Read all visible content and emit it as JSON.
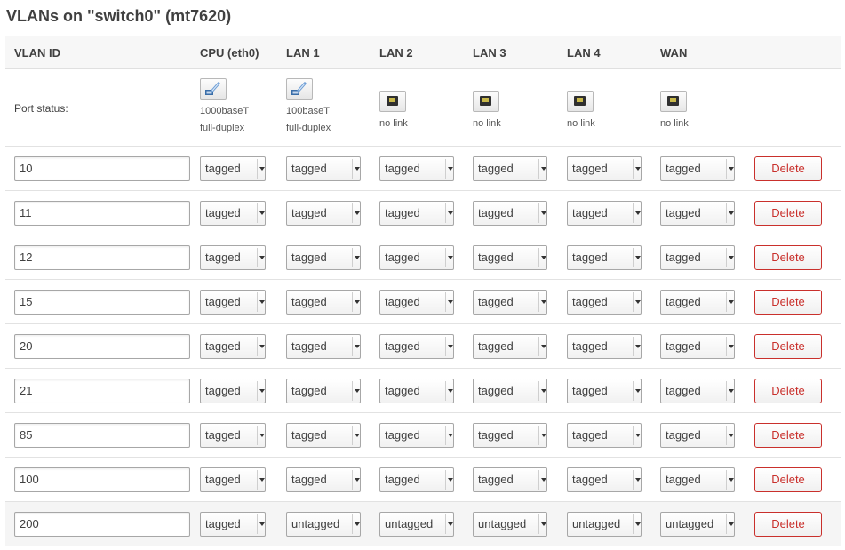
{
  "title": "VLANs on \"switch0\" (mt7620)",
  "columns": [
    "VLAN ID",
    "CPU (eth0)",
    "LAN 1",
    "LAN 2",
    "LAN 3",
    "LAN 4",
    "WAN"
  ],
  "status_label": "Port status:",
  "ports": [
    {
      "speed": "1000baseT",
      "duplex": "full-duplex",
      "icon": "ethernet-cable-connected-icon"
    },
    {
      "speed": "100baseT",
      "duplex": "full-duplex",
      "icon": "ethernet-cable-connected-icon"
    },
    {
      "speed": "no link",
      "duplex": "",
      "icon": "ethernet-port-empty-icon"
    },
    {
      "speed": "no link",
      "duplex": "",
      "icon": "ethernet-port-empty-icon"
    },
    {
      "speed": "no link",
      "duplex": "",
      "icon": "ethernet-port-empty-icon"
    },
    {
      "speed": "no link",
      "duplex": "",
      "icon": "ethernet-port-empty-icon"
    }
  ],
  "delete_label": "Delete",
  "rows": [
    {
      "vid": "10",
      "modes": [
        "tagged",
        "tagged",
        "tagged",
        "tagged",
        "tagged",
        "tagged"
      ]
    },
    {
      "vid": "11",
      "modes": [
        "tagged",
        "tagged",
        "tagged",
        "tagged",
        "tagged",
        "tagged"
      ]
    },
    {
      "vid": "12",
      "modes": [
        "tagged",
        "tagged",
        "tagged",
        "tagged",
        "tagged",
        "tagged"
      ]
    },
    {
      "vid": "15",
      "modes": [
        "tagged",
        "tagged",
        "tagged",
        "tagged",
        "tagged",
        "tagged"
      ]
    },
    {
      "vid": "20",
      "modes": [
        "tagged",
        "tagged",
        "tagged",
        "tagged",
        "tagged",
        "tagged"
      ]
    },
    {
      "vid": "21",
      "modes": [
        "tagged",
        "tagged",
        "tagged",
        "tagged",
        "tagged",
        "tagged"
      ]
    },
    {
      "vid": "85",
      "modes": [
        "tagged",
        "tagged",
        "tagged",
        "tagged",
        "tagged",
        "tagged"
      ]
    },
    {
      "vid": "100",
      "modes": [
        "tagged",
        "tagged",
        "tagged",
        "tagged",
        "tagged",
        "tagged"
      ]
    },
    {
      "vid": "200",
      "modes": [
        "tagged",
        "untagged",
        "untagged",
        "untagged",
        "untagged",
        "untagged"
      ]
    }
  ],
  "colors": {
    "delete_accent": "#c9302c",
    "header_bg": "#f7f7f7"
  }
}
